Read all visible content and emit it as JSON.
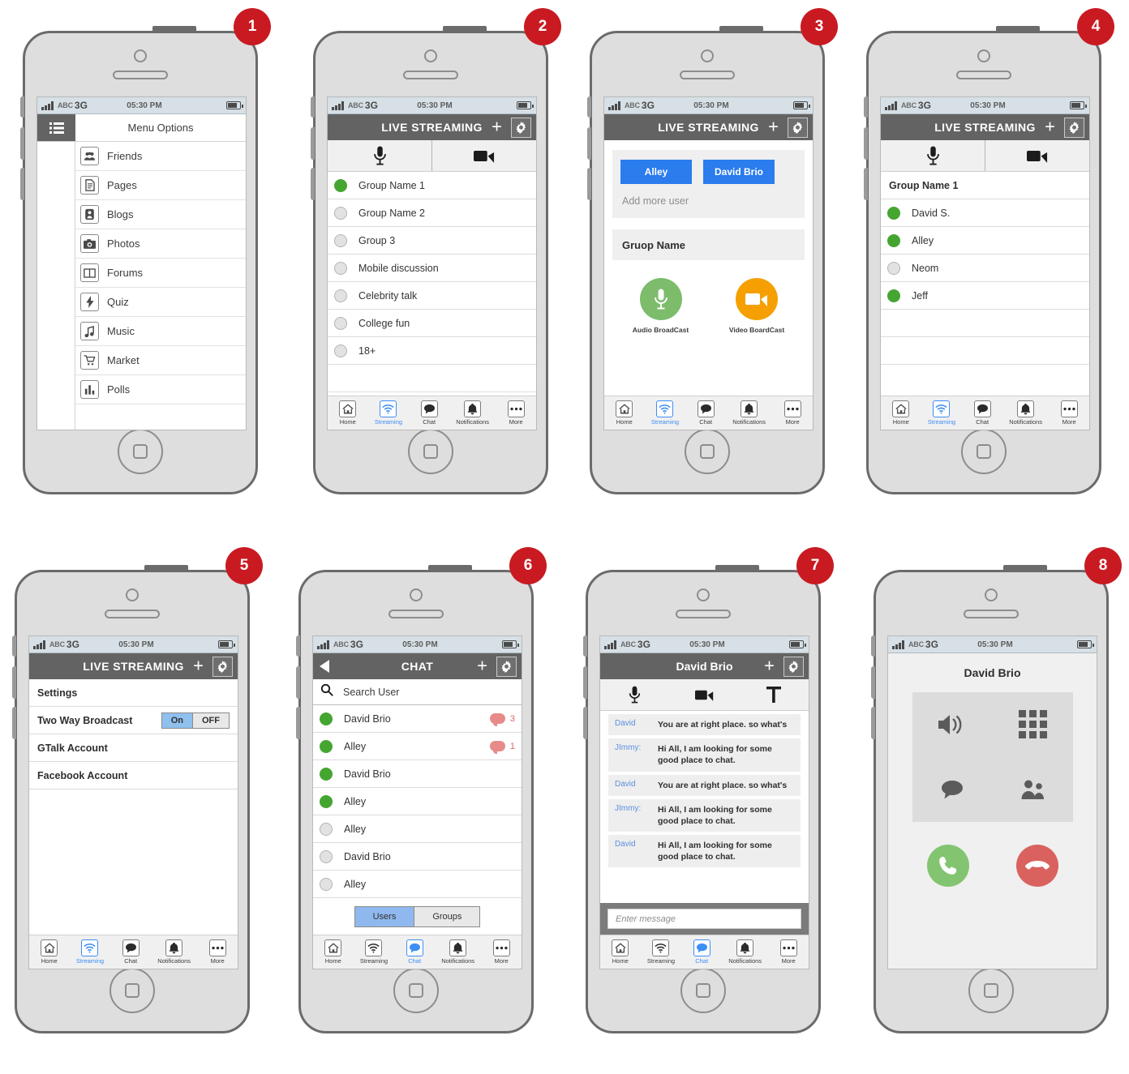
{
  "status_bar": {
    "carrier": "ABC",
    "network": "3G",
    "time": "05:30 PM"
  },
  "nav": {
    "items": [
      {
        "label": "Home",
        "icon": "home-icon"
      },
      {
        "label": "Streaming",
        "icon": "wifi-icon"
      },
      {
        "label": "Chat",
        "icon": "chat-bubble-icon"
      },
      {
        "label": "Notifications",
        "icon": "bell-icon"
      },
      {
        "label": "More",
        "icon": "ellipsis-icon"
      }
    ]
  },
  "screens": [
    {
      "number": "1",
      "drawer_title": "Menu Options",
      "menu": [
        {
          "label": "Friends",
          "icon": "friends-icon"
        },
        {
          "label": "Pages",
          "icon": "page-icon"
        },
        {
          "label": "Blogs",
          "icon": "blog-icon"
        },
        {
          "label": "Photos",
          "icon": "camera-icon"
        },
        {
          "label": "Forums",
          "icon": "forum-icon"
        },
        {
          "label": "Quiz",
          "icon": "lightning-icon"
        },
        {
          "label": "Music",
          "icon": "music-note-icon"
        },
        {
          "label": "Market",
          "icon": "cart-icon"
        },
        {
          "label": "Polls",
          "icon": "bar-chart-icon"
        }
      ]
    },
    {
      "number": "2",
      "header_title": "LIVE STREAMING",
      "groups": [
        {
          "name": "Group Name 1",
          "online": true
        },
        {
          "name": "Group Name 2",
          "online": false
        },
        {
          "name": "Group 3",
          "online": false
        },
        {
          "name": "Mobile discussion",
          "online": false
        },
        {
          "name": "Celebrity talk",
          "online": false
        },
        {
          "name": "College fun",
          "online": false
        },
        {
          "name": "18+",
          "online": false
        }
      ],
      "active_nav": "Streaming"
    },
    {
      "number": "3",
      "header_title": "LIVE STREAMING",
      "users": [
        "Alley",
        "David Brio"
      ],
      "add_more_label": "Add more user",
      "group_name_value": "Gruop Name",
      "broadcast": [
        {
          "label": "Audio BroadCast",
          "icon": "microphone-icon",
          "color": "#7cbc6b"
        },
        {
          "label": "Video BoardCast",
          "icon": "video-camera-icon",
          "color": "#f5a000"
        }
      ],
      "active_nav": "Streaming"
    },
    {
      "number": "4",
      "header_title": "LIVE STREAMING",
      "group_header": "Group Name 1",
      "members": [
        {
          "name": "David S.",
          "online": true
        },
        {
          "name": "Alley",
          "online": true
        },
        {
          "name": "Neom",
          "online": false
        },
        {
          "name": "Jeff",
          "online": true
        }
      ],
      "active_nav": "Streaming"
    },
    {
      "number": "5",
      "header_title": "LIVE STREAMING",
      "settings_title": "Settings",
      "settings": [
        {
          "label": "Two Way Broadcast",
          "toggle_on": "On",
          "toggle_off": "OFF",
          "state": "On"
        },
        {
          "label": "GTalk Account"
        },
        {
          "label": "Facebook Account"
        }
      ],
      "active_nav": "Streaming"
    },
    {
      "number": "6",
      "header_title": "CHAT",
      "search_placeholder": "Search User",
      "contacts": [
        {
          "name": "David Brio",
          "online": true,
          "unread": "3"
        },
        {
          "name": "Alley",
          "online": true,
          "unread": "1"
        },
        {
          "name": "David Brio",
          "online": true,
          "unread": ""
        },
        {
          "name": "Alley",
          "online": true,
          "unread": ""
        },
        {
          "name": "Alley",
          "online": false,
          "unread": ""
        },
        {
          "name": "David Brio",
          "online": false,
          "unread": ""
        },
        {
          "name": "Alley",
          "online": false,
          "unread": ""
        }
      ],
      "segments": [
        {
          "label": "Users",
          "selected": true
        },
        {
          "label": "Groups",
          "selected": false
        }
      ],
      "active_nav": "Chat"
    },
    {
      "number": "7",
      "header_title": "David Brio",
      "messages": [
        {
          "who": "David",
          "text": "You are at right place. so what's"
        },
        {
          "who": "JImmy:",
          "text": "Hi All, I am looking for some good place to chat."
        },
        {
          "who": "David",
          "text": "You are at right place. so what's"
        },
        {
          "who": "JImmy:",
          "text": "Hi All, I am looking for some good place to chat."
        },
        {
          "who": "David",
          "text": "Hi All, I am looking for some good place to chat."
        }
      ],
      "input_placeholder": "Enter message",
      "active_nav": "Chat"
    },
    {
      "number": "8",
      "call_name": "David Brio",
      "call_options": [
        {
          "icon": "speaker-icon"
        },
        {
          "icon": "keypad-icon"
        },
        {
          "icon": "chat-bubble-icon"
        },
        {
          "icon": "add-contacts-icon"
        }
      ],
      "call_actions": [
        {
          "icon": "phone-answer-icon",
          "color": "#83c471"
        },
        {
          "icon": "phone-hangup-icon",
          "color": "#d9625f"
        }
      ]
    }
  ]
}
